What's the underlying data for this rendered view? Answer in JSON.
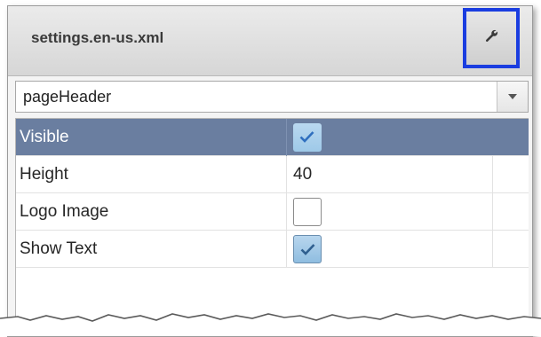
{
  "panel": {
    "title": "settings.en-us.xml",
    "settings_button": {
      "icon": "wrench-icon"
    }
  },
  "dropdown": {
    "selected": "pageHeader",
    "arrow_icon": "chevron-down-icon"
  },
  "properties": [
    {
      "name": "Visible",
      "type": "checkbox",
      "checked": true,
      "selected": true
    },
    {
      "name": "Height",
      "type": "text",
      "value": "40",
      "selected": false
    },
    {
      "name": "Logo Image",
      "type": "checkbox",
      "checked": false,
      "selected": false
    },
    {
      "name": "Show Text",
      "type": "checkbox",
      "checked": true,
      "selected": false
    }
  ],
  "colors": {
    "highlight_border": "#1a3de0",
    "selected_row": "#6a7ea0",
    "checkbox_fill": "#9ec9e8",
    "check_mark": "#2f6fbf"
  }
}
